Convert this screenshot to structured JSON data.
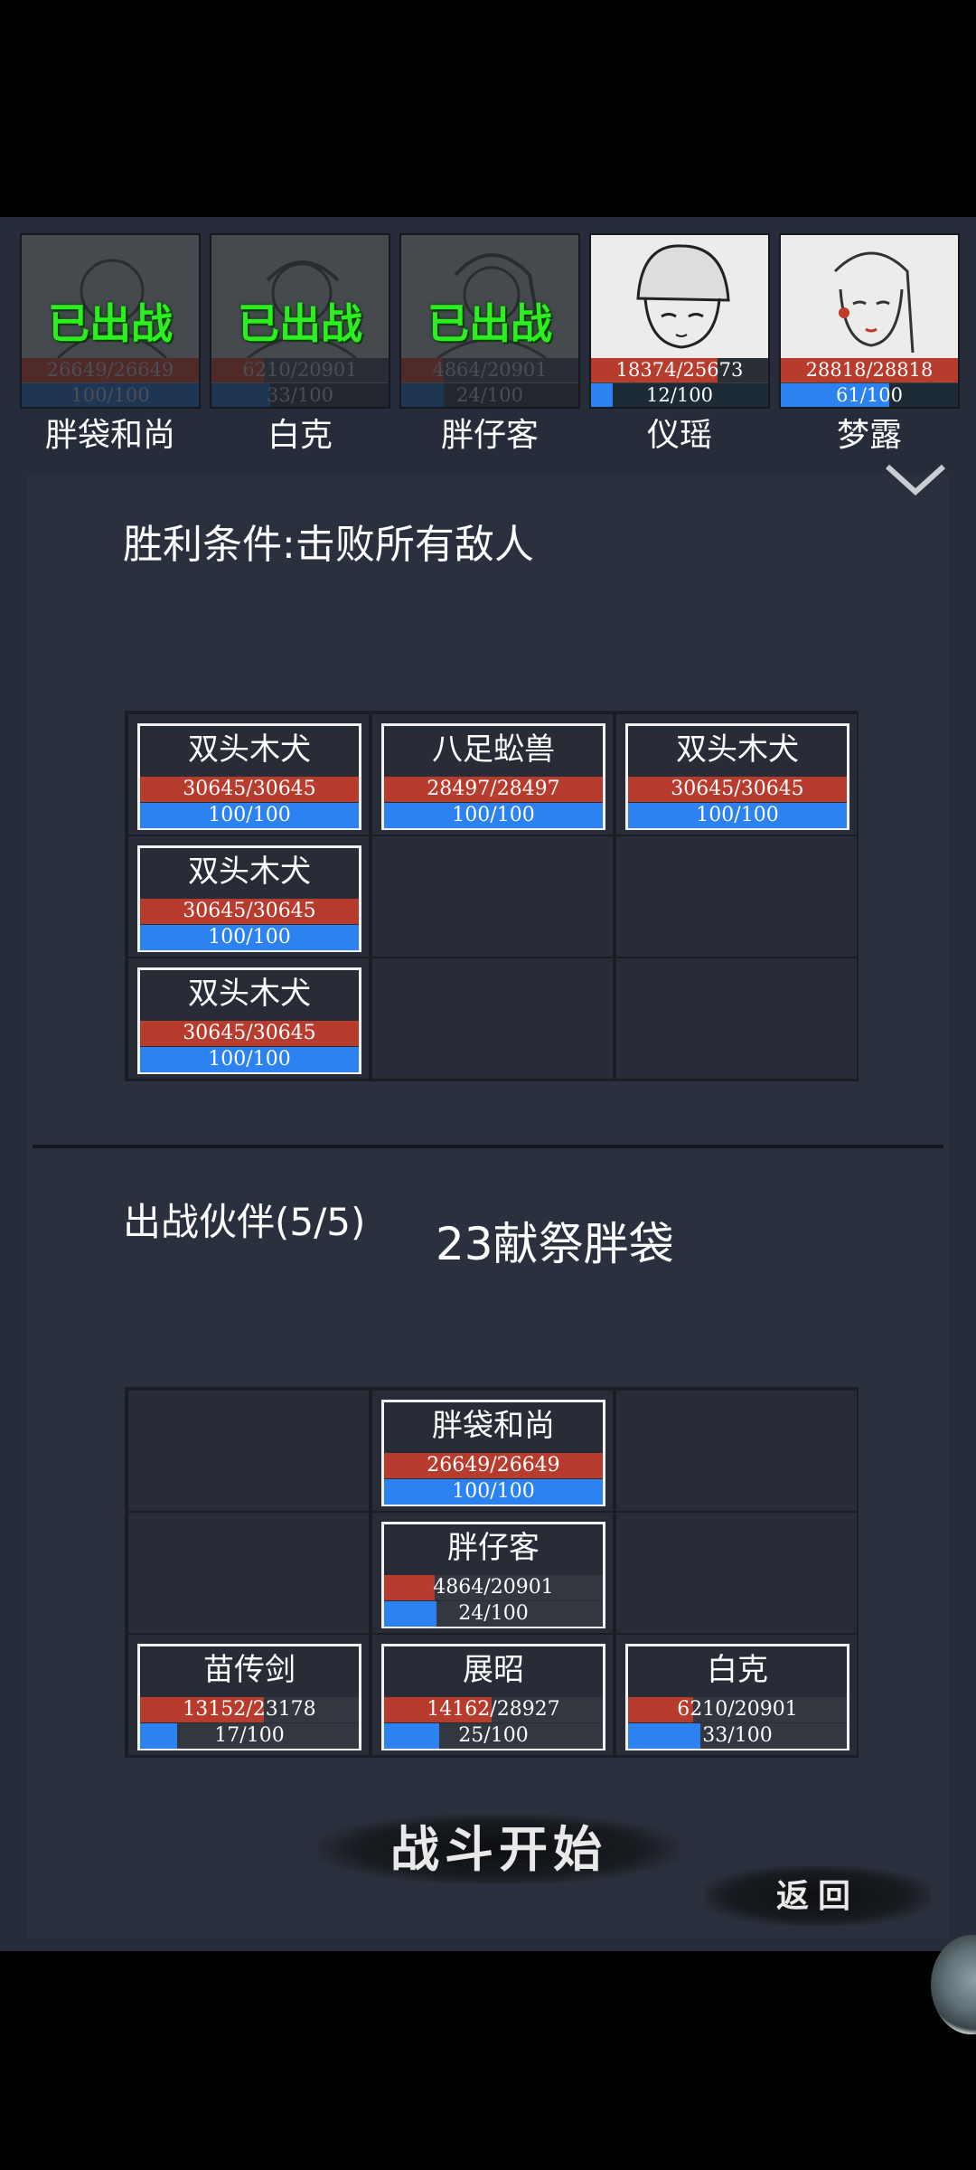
{
  "roster": [
    {
      "name": "胖袋和尚",
      "hp": "26649/26649",
      "hp_frac": 1.0,
      "mp": "100/100",
      "mp_frac": 1.0,
      "status": "已出战",
      "deployed": true
    },
    {
      "name": "白克",
      "hp": "6210/20901",
      "hp_frac": 0.297,
      "mp": "33/100",
      "mp_frac": 0.33,
      "status": "已出战",
      "deployed": true
    },
    {
      "name": "胖仔客",
      "hp": "4864/20901",
      "hp_frac": 0.233,
      "mp": "24/100",
      "mp_frac": 0.24,
      "status": "已出战",
      "deployed": true
    },
    {
      "name": "仪瑶",
      "hp": "18374/25673",
      "hp_frac": 0.716,
      "mp": "12/100",
      "mp_frac": 0.12,
      "status": "",
      "deployed": false
    },
    {
      "name": "梦露",
      "hp": "28818/28818",
      "hp_frac": 1.0,
      "mp": "61/100",
      "mp_frac": 0.61,
      "status": "",
      "deployed": false
    }
  ],
  "victory": "胜利条件:击败所有敌人",
  "enemies": [
    {
      "slot": 0,
      "name": "双头木犬",
      "hp": "30645/30645",
      "hp_frac": 1.0,
      "mp": "100/100",
      "mp_frac": 1.0
    },
    {
      "slot": 1,
      "name": "八足蚣兽",
      "hp": "28497/28497",
      "hp_frac": 1.0,
      "mp": "100/100",
      "mp_frac": 1.0
    },
    {
      "slot": 2,
      "name": "双头木犬",
      "hp": "30645/30645",
      "hp_frac": 1.0,
      "mp": "100/100",
      "mp_frac": 1.0
    },
    {
      "slot": 3,
      "name": "双头木犬",
      "hp": "30645/30645",
      "hp_frac": 1.0,
      "mp": "100/100",
      "mp_frac": 1.0
    },
    {
      "slot": 6,
      "name": "双头木犬",
      "hp": "30645/30645",
      "hp_frac": 1.0,
      "mp": "100/100",
      "mp_frac": 1.0
    }
  ],
  "party_label": "出战伙伴(5/5)",
  "sacrifice": "23献祭胖袋",
  "allies": [
    {
      "slot": 1,
      "name": "胖袋和尚",
      "hp": "26649/26649",
      "hp_frac": 1.0,
      "mp": "100/100",
      "mp_frac": 1.0
    },
    {
      "slot": 4,
      "name": "胖仔客",
      "hp": "4864/20901",
      "hp_frac": 0.233,
      "mp": "24/100",
      "mp_frac": 0.24
    },
    {
      "slot": 6,
      "name": "苗传剑",
      "hp": "13152/23178",
      "hp_frac": 0.567,
      "mp": "17/100",
      "mp_frac": 0.17
    },
    {
      "slot": 7,
      "name": "展昭",
      "hp": "14162/28927",
      "hp_frac": 0.49,
      "mp": "25/100",
      "mp_frac": 0.25
    },
    {
      "slot": 8,
      "name": "白克",
      "hp": "6210/20901",
      "hp_frac": 0.297,
      "mp": "33/100",
      "mp_frac": 0.33
    }
  ],
  "buttons": {
    "start": "战斗开始",
    "back": "返回"
  },
  "colors": {
    "hp": "#b83c2e",
    "mp": "#2b82f0",
    "deployed_tag": "#2cef20",
    "panel": "#2a303d"
  }
}
